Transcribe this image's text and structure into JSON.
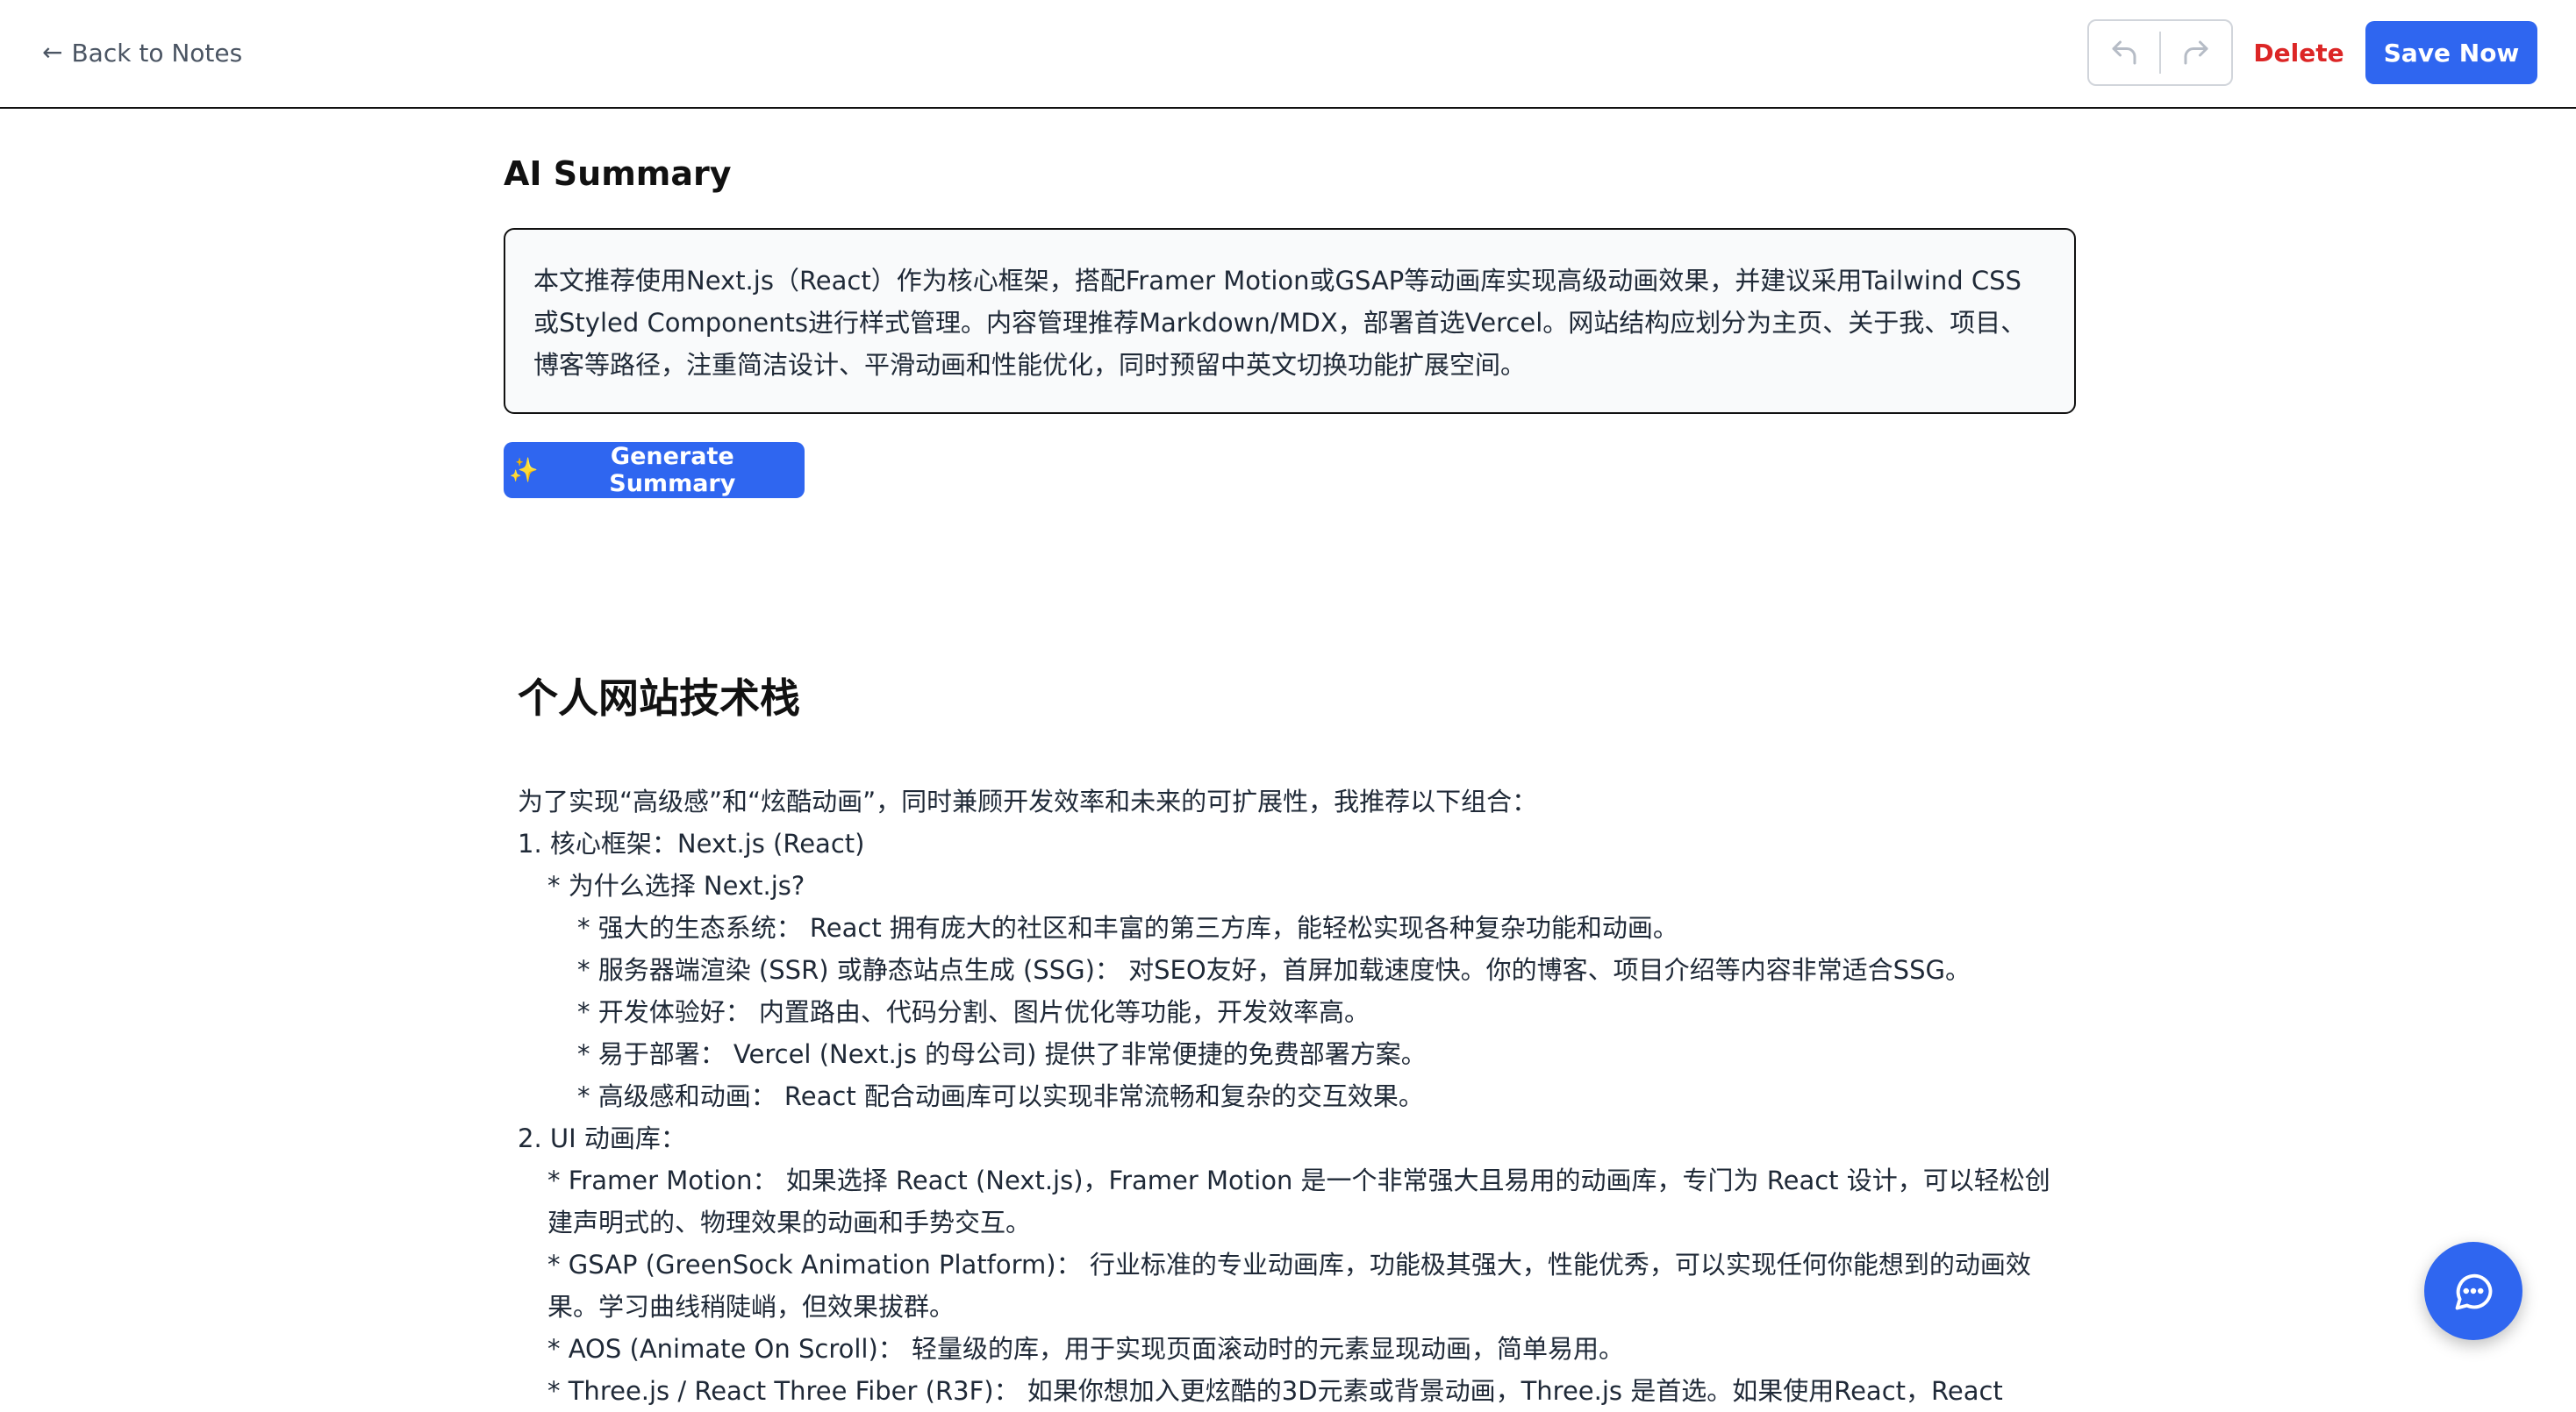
{
  "header": {
    "back_label": "Back to Notes",
    "back_icon": "arrow-left-icon",
    "undo_icon": "undo-icon",
    "redo_icon": "redo-icon",
    "delete_label": "Delete",
    "save_label": "Save Now"
  },
  "summary": {
    "title": "AI Summary",
    "text": "本文推荐使用Next.js（React）作为核心框架，搭配Framer Motion或GSAP等动画库实现高级动画效果，并建议采用Tailwind CSS或Styled Components进行样式管理。内容管理推荐Markdown/MDX，部署首选Vercel。网站结构应划分为主页、关于我、项目、博客等路径，注重简洁设计、平滑动画和性能优化，同时预留中英文切换功能扩展空间。",
    "generate_icon": "✨",
    "generate_label": "Generate Summary"
  },
  "document": {
    "title": "个人网站技术栈",
    "lines": [
      {
        "indent": 0,
        "text": "为了实现“高级感”和“炫酷动画”，同时兼顾开发效率和未来的可扩展性，我推荐以下组合："
      },
      {
        "indent": 0,
        "text": "1. 核心框架：Next.js (React)"
      },
      {
        "indent": 1,
        "text": "* 为什么选择 Next.js?"
      },
      {
        "indent": 2,
        "text": "* 强大的生态系统： React 拥有庞大的社区和丰富的第三方库，能轻松实现各种复杂功能和动画。"
      },
      {
        "indent": 2,
        "text": "* 服务器端渲染 (SSR) 或静态站点生成 (SSG)： 对SEO友好，首屏加载速度快。你的博客、项目介绍等内容非常适合SSG。"
      },
      {
        "indent": 2,
        "text": "* 开发体验好： 内置路由、代码分割、图片优化等功能，开发效率高。"
      },
      {
        "indent": 2,
        "text": "* 易于部署： Vercel (Next.js 的母公司) 提供了非常便捷的免费部署方案。"
      },
      {
        "indent": 2,
        "text": "* 高级感和动画： React 配合动画库可以实现非常流畅和复杂的交互效果。"
      },
      {
        "indent": 0,
        "text": "2. UI 动画库："
      },
      {
        "indent": 1,
        "text": "* Framer Motion： 如果选择 React (Next.js)，Framer Motion 是一个非常强大且易用的动画库，专门为 React 设计，可以轻松创建声明式的、物理效果的动画和手势交互。"
      },
      {
        "indent": 1,
        "text": "* GSAP (GreenSock Animation Platform)： 行业标准的专业动画库，功能极其强大，性能优秀，可以实现任何你能想到的动画效果。学习曲线稍陡峭，但效果拔群。"
      },
      {
        "indent": 1,
        "text": "* AOS (Animate On Scroll)： 轻量级的库，用于实现页面滚动时的元素显现动画，简单易用。"
      },
      {
        "indent": 1,
        "text": "* Three.js / React Three Fiber (R3F)： 如果你想加入更炫酷的3D元素或背景动画，Three.js 是首选。如果使用React，React"
      }
    ]
  },
  "chat": {
    "icon": "chat-bubble-icon"
  },
  "colors": {
    "primary": "#2f66f0",
    "danger": "#dc2626",
    "summary_bg": "#f9fafb"
  }
}
